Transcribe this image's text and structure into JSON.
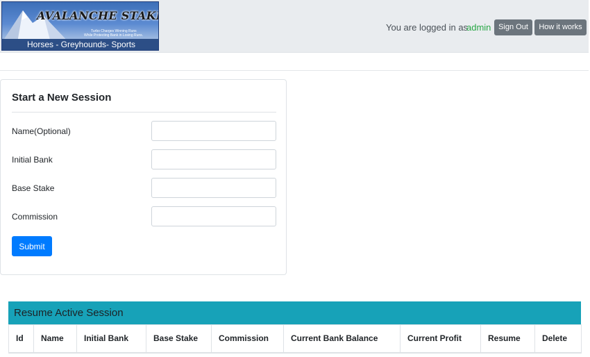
{
  "header": {
    "logo": {
      "title": "AVALANCHE STAKING",
      "tagline_1": "Turbo Charges Winning Runs",
      "tagline_2": "While Protecting Bank in Losing Runs.",
      "subtitle": "Horses - Greyhounds- Sports"
    },
    "login_text": "You are logged in as",
    "username": "admin",
    "sign_out_label": "Sign Out",
    "how_it_works_label": "How it works"
  },
  "new_session": {
    "title": "Start a New Session",
    "fields": [
      {
        "label": "Name(Optional)",
        "value": ""
      },
      {
        "label": "Initial Bank",
        "value": ""
      },
      {
        "label": "Base Stake",
        "value": ""
      },
      {
        "label": "Commission",
        "value": ""
      }
    ],
    "submit_label": "Submit"
  },
  "resume_session": {
    "title": "Resume Active Session",
    "columns": [
      "Id",
      "Name",
      "Initial Bank",
      "Base Stake",
      "Commission",
      "Current Bank Balance",
      "Current Profit",
      "Resume",
      "Delete"
    ]
  },
  "colors": {
    "navbar_bg": "#e9ecef",
    "primary": "#007bff",
    "secondary": "#6c757d",
    "success": "#28a745",
    "info": "#17a2b8"
  }
}
